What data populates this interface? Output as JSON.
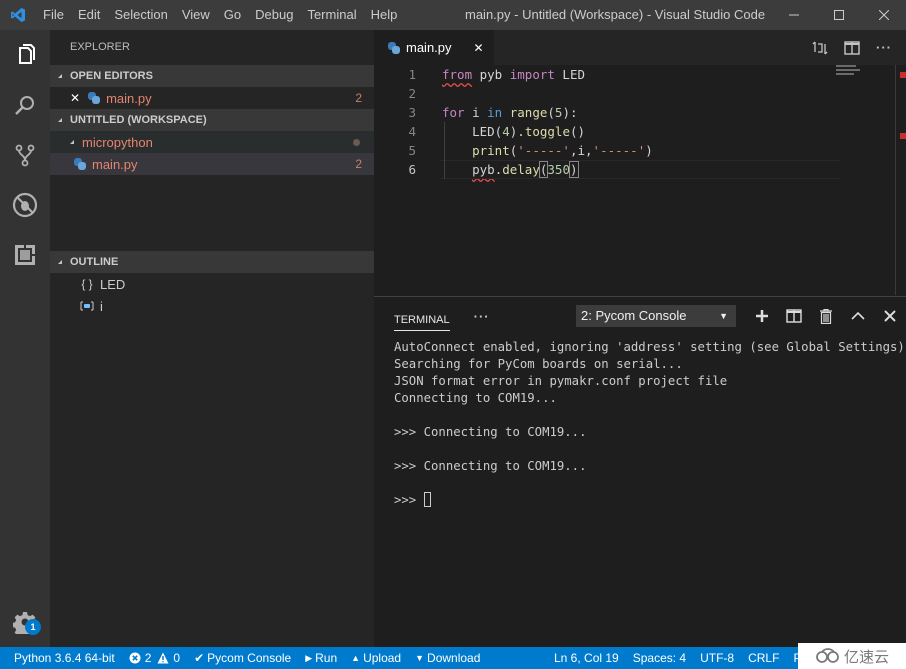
{
  "titlebar": {
    "menu": [
      "File",
      "Edit",
      "Selection",
      "View",
      "Go",
      "Debug",
      "Terminal",
      "Help"
    ],
    "window_title": "main.py - Untitled (Workspace) - Visual Studio Code"
  },
  "activitybar": {
    "items": [
      "explorer",
      "search",
      "source-control",
      "debug",
      "extensions"
    ],
    "settings_badge": "1"
  },
  "sidebar": {
    "title": "EXPLORER",
    "open_editors": {
      "header": "OPEN EDITORS",
      "items": [
        {
          "name": "main.py",
          "count": "2"
        }
      ]
    },
    "workspace": {
      "header": "UNTITLED (WORKSPACE)",
      "folder": "micropython",
      "files": [
        {
          "name": "main.py",
          "count": "2"
        }
      ]
    },
    "outline": {
      "header": "OUTLINE",
      "items": [
        {
          "icon": "{ }",
          "label": "LED"
        },
        {
          "icon": "variable",
          "label": "i"
        }
      ]
    }
  },
  "editor": {
    "tab": {
      "label": "main.py"
    },
    "lines": [
      {
        "n": "1"
      },
      {
        "n": "2"
      },
      {
        "n": "3"
      },
      {
        "n": "4"
      },
      {
        "n": "5"
      },
      {
        "n": "6"
      }
    ],
    "code": {
      "l1": {
        "from": "from",
        "a": " pyb ",
        "import": "import",
        "b": " LED"
      },
      "l3": {
        "for": "for",
        "a": " i ",
        "in": "in",
        "b": " ",
        "range": "range",
        "c": "(",
        "num": "5",
        "d": "):"
      },
      "l4": {
        "indent": "    ",
        "a": "LED(",
        "num": "4",
        "b": ").",
        "fn": "toggle",
        "c": "()"
      },
      "l5": {
        "indent": "    ",
        "fn": "print",
        "a": "(",
        "s1": "'-----'",
        "b": ",i,",
        "s2": "'-----'",
        "c": ")"
      },
      "l6": {
        "indent": "    ",
        "pyb": "pyb",
        "a": ".",
        "fn": "delay",
        "open": "(",
        "num": "350",
        "close": ")"
      }
    }
  },
  "panel": {
    "tab": "TERMINAL",
    "more": "···",
    "terminal_select": "2: Pycom Console",
    "lines": [
      "AutoConnect enabled, ignoring 'address' setting (see Global Settings)",
      "Searching for PyCom boards on serial...",
      "JSON format error in pymakr.conf project file",
      "Connecting to COM19...",
      "",
      ">>> Connecting to COM19...",
      "",
      ">>> Connecting to COM19...",
      ""
    ],
    "prompt": ">>> "
  },
  "statusbar": {
    "python": "Python 3.6.4 64-bit",
    "errors": "2",
    "warnings": "0",
    "pycom_console": "Pycom Console",
    "run": "Run",
    "upload": "Upload",
    "download": "Download",
    "position": "Ln 6, Col 19",
    "spaces": "Spaces: 4",
    "encoding": "UTF-8",
    "eol": "CRLF",
    "language": "Py"
  },
  "watermark": "亿速云",
  "colors": {
    "statusbar": "#007acc",
    "titlebar": "#3c3c3c",
    "activitybar": "#333333",
    "sidebar": "#252526",
    "editor": "#1e1e1e",
    "error_file": "#e5856e"
  }
}
